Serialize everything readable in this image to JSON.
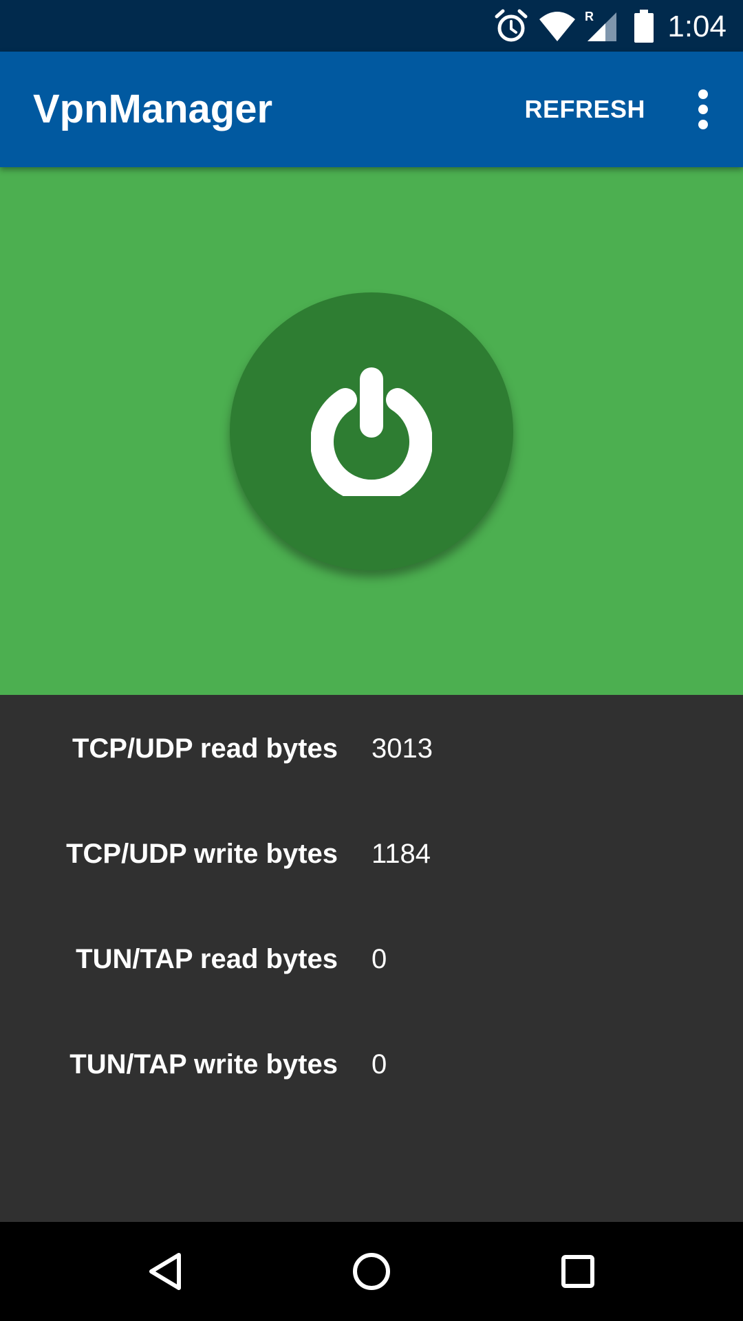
{
  "status_bar": {
    "time": "1:04",
    "roaming_indicator": "R",
    "icons": [
      "alarm-icon",
      "wifi-icon",
      "cell-signal-icon",
      "battery-icon"
    ]
  },
  "app_bar": {
    "title": "VpnManager",
    "refresh_label": "REFRESH",
    "overflow_icon": "more-vert-icon"
  },
  "power": {
    "icon": "power-icon",
    "colors": {
      "area_background": "#4caf50",
      "button_background": "#2e7d32"
    }
  },
  "stats": [
    {
      "label": "TCP/UDP read bytes",
      "value": "3013"
    },
    {
      "label": "TCP/UDP write bytes",
      "value": "1184"
    },
    {
      "label": "TUN/TAP read bytes",
      "value": "0"
    },
    {
      "label": "TUN/TAP write bytes",
      "value": "0"
    }
  ],
  "nav_bar": {
    "icons": [
      "back-icon",
      "home-icon",
      "recents-icon"
    ]
  },
  "colors": {
    "status_bar": "#012a4d",
    "app_bar": "#0159a0",
    "stats_background": "#303030"
  }
}
